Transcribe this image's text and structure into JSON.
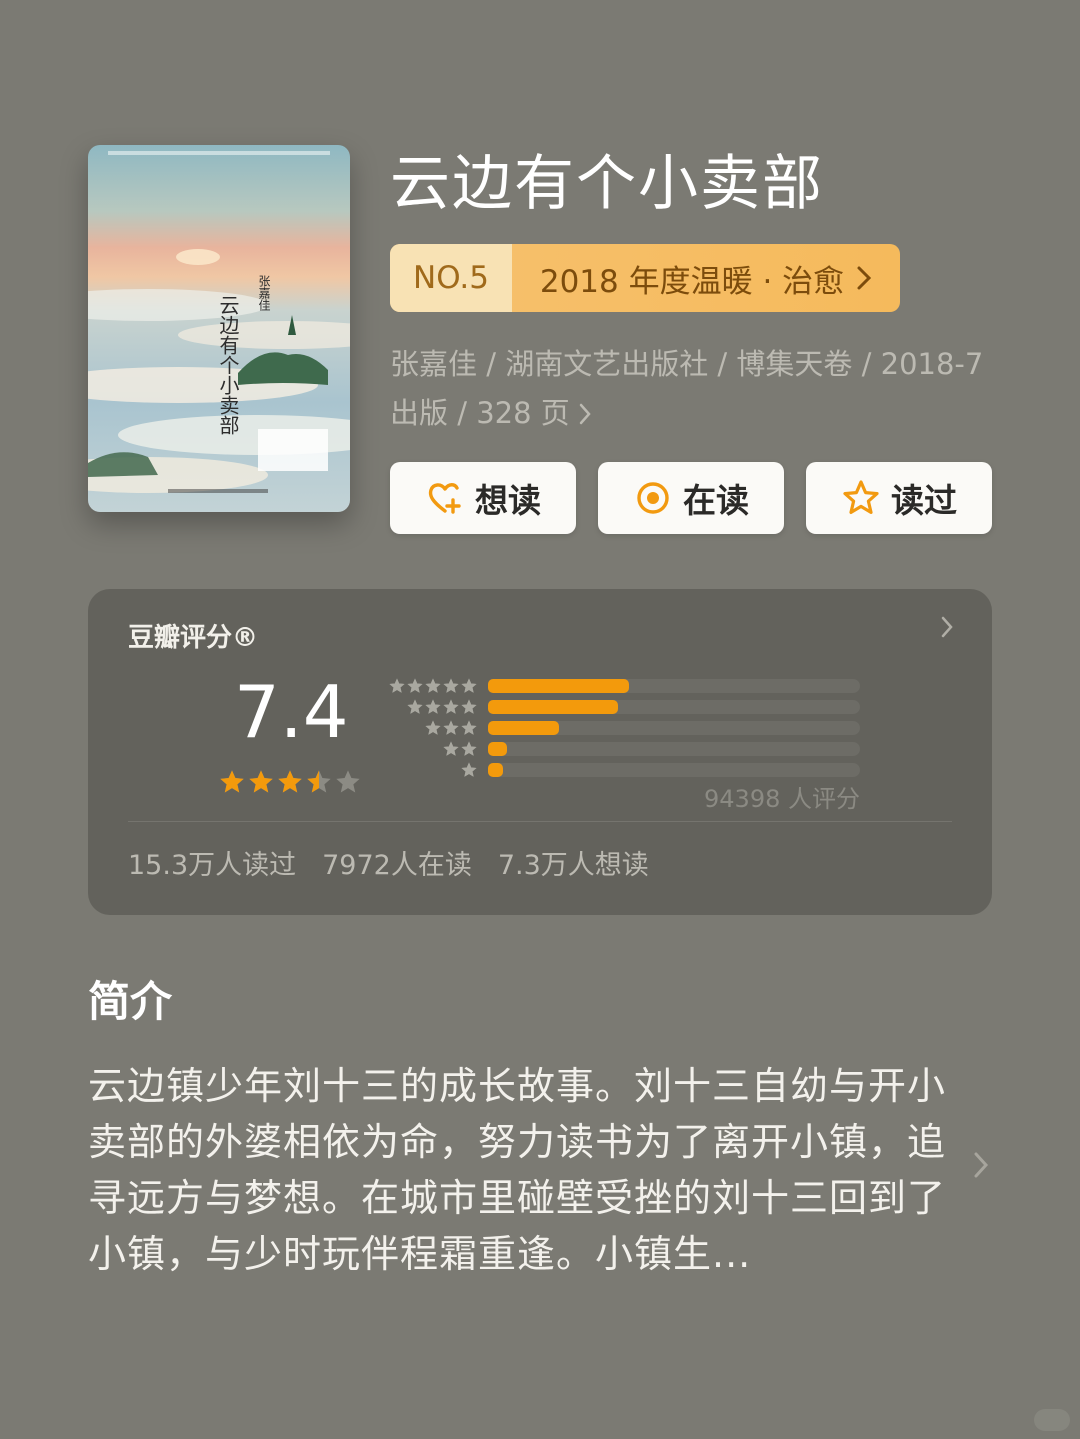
{
  "book": {
    "title": "云边有个小卖部",
    "cover": {
      "title_text": "云边有个小卖部",
      "author_text": "张嘉佳"
    }
  },
  "rank": {
    "no_label": "NO.5",
    "list_label": "2018 年度温暖 · 治愈"
  },
  "meta": {
    "line1": "张嘉佳 / 湖南文艺出版社 / 博集天卷 / 2018-7",
    "line2": "出版 / 328 页"
  },
  "actions": {
    "want_label": "想读",
    "reading_label": "在读",
    "read_label": "读过"
  },
  "rating": {
    "title": "豆瓣评分®",
    "score": "7.4",
    "stars": 3.5,
    "distribution_fraction": [
      0.38,
      0.35,
      0.19,
      0.05,
      0.04
    ],
    "count_text": "94398 人评分",
    "stats": [
      "15.3万人读过",
      "7972人在读",
      "7.3万人想读"
    ]
  },
  "intro": {
    "heading": "简介",
    "body": "云边镇少年刘十三的成长故事。刘十三自幼与开小卖部的外婆相依为命，努力读书为了离开小镇，追寻远方与梦想。在城市里碰壁受挫的刘十三回到了小镇，与少时玩伴程霜重逢。小镇生..."
  },
  "colors": {
    "background": "#7b7a73",
    "card": "#63625c",
    "accent_orange": "#f39a0c",
    "rank_gold": "#f5ba5c"
  }
}
